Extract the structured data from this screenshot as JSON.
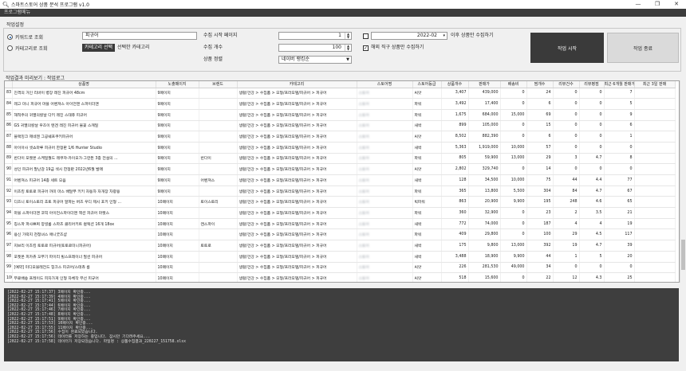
{
  "window": {
    "title": "스마트스토어 상품 분석 프로그램 v1.0",
    "icon": "magnifier-icon",
    "controls": [
      "—",
      "❐",
      "✕"
    ]
  },
  "menubar": {
    "label": "프로그램메뉴"
  },
  "settings": {
    "section_label": "작업설정",
    "keyword_radio": "키워드로 조회",
    "category_radio": "카테고리로 조회",
    "keyword_value": "피규어",
    "category_button": "카테고리 선택",
    "category_text": "선택한 카테고리",
    "start_page_label": "수집 시작 페이지",
    "start_page_value": "1",
    "count_label": "수집 개수",
    "count_value": "100",
    "sort_label": "상품 정렬",
    "sort_value": "네이버 랭킹순",
    "date_value": "2022-02",
    "date_suffix": "이후 상품만 수집하기",
    "overseas_label": "해외 직구 상품만 수집하기",
    "start_button": "작업 시작",
    "end_button": "작업 종료"
  },
  "results_label": "작업결과 미리보기 : 작업로그",
  "table": {
    "columns": [
      "",
      "상품명",
      "노출페이지",
      "브랜드",
      "카테고리",
      "스토어명",
      "스토어등급",
      "상품개수",
      "판매가",
      "배송비",
      "찜개수",
      "리뷰건수",
      "리뷰평점",
      "최근 6개월 판매개수",
      "최근 3일 판매"
    ],
    "rows": [
      [
        "83",
        "진격의 거인 리바이 병장 레진 피규어 48cm",
        "9페이지",
        "",
        "생활/건강 > 수집품 > 모형/프라모델/피규어 > 피규어",
        "스토어",
        "씨앗",
        "3,407",
        "439,000",
        "0",
        "24",
        "0",
        "0",
        "7",
        ""
      ],
      [
        "84",
        "레고 미니 피규어 마블 어벤져스 아이언맨 스파이더맨",
        "9페이지",
        "",
        "생활/건강 > 수집품 > 모형/프라모델/피규어 > 피규어",
        "스토어",
        "파워",
        "3,492",
        "17,400",
        "0",
        "6",
        "0",
        "0",
        "5",
        ""
      ],
      [
        "85",
        "해적주의 귀멸의칼날 다키 레진 스태츄 피규어",
        "9페이지",
        "",
        "생활/건강 > 수집품 > 모형/프라모델/피규어 > 피규어",
        "스토어",
        "파워",
        "1,675",
        "684,000",
        "15,000",
        "69",
        "0",
        "0",
        "9",
        ""
      ],
      [
        "86",
        "GS 귀멸의칼날 우즈이 텐겐 레진 피규어 불꽃 스캐일",
        "9페이지",
        "",
        "생활/건강 > 수집품 > 모형/프라모델/피규어 > 피규어",
        "스토어",
        "새싹",
        "899",
        "105,000",
        "0",
        "15",
        "0",
        "0",
        "6",
        ""
      ],
      [
        "87",
        "블랙잉크 제네젠 그공쉐프쿠키피규어",
        "9페이지",
        "",
        "생활/건강 > 수집품 > 모형/프라모델/피규어 > 피규어",
        "스토어",
        "씨앗",
        "8,502",
        "882,390",
        "0",
        "6",
        "0",
        "0",
        "1",
        ""
      ],
      [
        "88",
        "아이아사 셋쇼마루 피규어 한정판 1/6 Hunter Studio",
        "9페이지",
        "",
        "생활/건강 > 수집품 > 모형/프라모델/피규어 > 피규어",
        "스토어",
        "새싹",
        "5,363",
        "1,919,000",
        "10,000",
        "57",
        "0",
        "0",
        "0",
        ""
      ],
      [
        "89",
        "반다이 포켓몬 스케일월드 레쿠쟈·카이오가·그란돈 3종 전설의 ...",
        "9페이지",
        "반다이",
        "생활/건강 > 수집품 > 모형/프라모델/피규어 > 피규어",
        "스토어",
        "파워",
        "805",
        "59,900",
        "13,000",
        "29",
        "3",
        "4.7",
        "8",
        ""
      ],
      [
        "90",
        "성인 피규어 말난감 19금 섹시 한정판 2022년6월 발매",
        "9페이지",
        "",
        "생활/건강 > 수집품 > 모형/프라모델/피규어 > 피규어",
        "스토어",
        "씨앗",
        "2,802",
        "329,740",
        "0",
        "14",
        "0",
        "0",
        "0",
        ""
      ],
      [
        "91",
        "어벤져스 피규어 14종 세트 모음",
        "9페이지",
        "어벤져스",
        "생활/건강 > 수집품 > 모형/프라모델/피규어 > 피규어",
        "스토어",
        "새싹",
        "128",
        "34,500",
        "10,000",
        "75",
        "44",
        "4.4",
        "77",
        ""
      ],
      [
        "92",
        "이츠킹 토토로 피규어 까미 마스 배달부 키키 자동차 자개장 차량용",
        "9페이지",
        "",
        "생활/건강 > 수집품 > 모형/프라모델/피규어 > 피규어",
        "스토어",
        "파워",
        "365",
        "13,800",
        "5,500",
        "304",
        "84",
        "4.7",
        "67",
        ""
      ],
      [
        "93",
        "디즈니 토이스토리 초토 피규어 알파는 버즈 우디 제시 포키 인형 ...",
        "10페이지",
        "토이스토리",
        "생활/건강 > 수집품 > 모형/프라모델/피규어 > 피규어",
        "스토어",
        "빅파워",
        "863",
        "20,900",
        "9,900",
        "195",
        "248",
        "4.6",
        "65",
        ""
      ],
      [
        "94",
        "마블 스파이더맨 코믹 아이언스파이더맨 액션 피규어 마켓스",
        "10페이지",
        "",
        "생활/건강 > 수집품 > 모형/프라모델/피규어 > 피규어",
        "스토어",
        "파워",
        "360",
        "32,900",
        "0",
        "23",
        "2",
        "3.5",
        "21",
        ""
      ],
      [
        "95",
        "칭스파 파사쁘쩌 양셜롬 스파츠 클리어키트 컬렉션 16개 18ox",
        "10페이지",
        "캔스파이",
        "생활/건강 > 수집품 > 모형/프라모델/피규어 > 피규어",
        "스토어",
        "새싹",
        "772",
        "74,000",
        "0",
        "187",
        "4",
        "4",
        "19",
        ""
      ],
      [
        "96",
        "용신 가락지 천청녀스 애니굿즈샵",
        "10페이지",
        "",
        "생활/건강 > 수집품 > 모형/프라모델/피규어 > 피규어",
        "스토어",
        "파워",
        "409",
        "29,800",
        "0",
        "100",
        "29",
        "4.5",
        "117",
        ""
      ],
      [
        "97",
        "지브리 이츠킹 토토로 피규어(토토로미니피규어)",
        "10페이지",
        "토토로",
        "생활/건강 > 수집품 > 모형/프라모델/피규어 > 피규어",
        "스토어",
        "새싹",
        "175",
        "9,800",
        "13,000",
        "392",
        "19",
        "4.7",
        "39",
        ""
      ],
      [
        "98",
        "포켓몬 피카츄 꼬부기 파이리 빌스프레이너 필씬 피규어",
        "10페이지",
        "",
        "생활/건강 > 수집품 > 모형/프라모델/피규어 > 피규어",
        "스토어",
        "새싹",
        "3,488",
        "18,900",
        "9,900",
        "44",
        "1",
        "5",
        "20",
        ""
      ],
      [
        "99",
        "[예약] 미디오블레전드 힝크스 피규어/스테츄 룸",
        "10페이지",
        "",
        "생활/건강 > 수집품 > 모형/프라모델/피규어 > 피규어",
        "스토어",
        "씨앗",
        "226",
        "281,530",
        "49,000",
        "34",
        "0",
        "0",
        "0",
        ""
      ],
      [
        "100",
        "무료배송 프레이드 피자가게 인형 자체작 무선 피규어",
        "10페이지",
        "",
        "생활/건강 > 수집품 > 모형/프라모델/피규어 > 피규어",
        "스토어",
        "씨앗",
        "518",
        "15,600",
        "0",
        "22",
        "12",
        "4.3",
        "25",
        ""
      ]
    ]
  },
  "log": {
    "lines": [
      "[2022-02-27 15:17:37] 3페이지 확인중...",
      "[2022-02-27 15:17:39] 4페이지 확인중...",
      "[2022-02-27 15:17:41] 5페이지 확인중...",
      "[2022-02-27 15:17:44] 6페이지 확인중...",
      "[2022-02-27 15:17:46] 7페이지 확인중...",
      "[2022-02-27 15:17:48] 8페이지 확인중...",
      "[2022-02-27 15:17:51] 9페이지 확인중...",
      "[2022-02-27 15:17:53] 10페이지 확인중...",
      "[2022-02-27 15:17:55] 11페이지 확인중...",
      "[2022-02-27 15:17:56] 수집이 완료되었습니다.",
      "[2022-02-27 15:17:56] 데이터를 저장하는 중입니다. 잠시만 기다려주세요...",
      "[2022-02-27 15:17:58] 데이터가 저장되었습니다. 파일명 : 상품수집결과_220227_151758.xlsx"
    ]
  }
}
